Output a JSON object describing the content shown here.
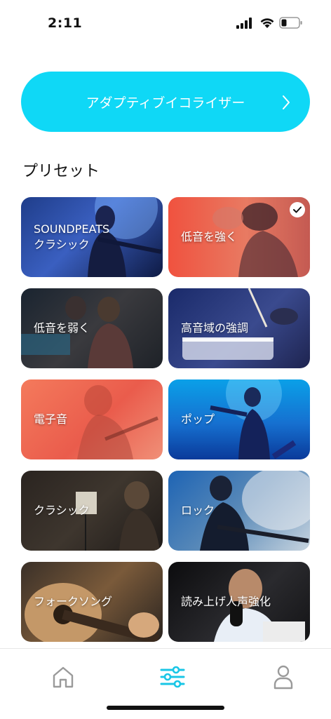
{
  "status_bar": {
    "time": "2:11"
  },
  "eq_button": {
    "label": "アダプティブイコライザー"
  },
  "presets": {
    "title": "プリセット",
    "items": [
      {
        "label": "SOUNDPEATS\nクラシック",
        "selected": false
      },
      {
        "label": "低音を強く",
        "selected": true
      },
      {
        "label": "低音を弱く",
        "selected": false
      },
      {
        "label": "高音域の強調",
        "selected": false
      },
      {
        "label": "電子音",
        "selected": false
      },
      {
        "label": "ポップ",
        "selected": false
      },
      {
        "label": "クラシック",
        "selected": false
      },
      {
        "label": "ロック",
        "selected": false
      },
      {
        "label": "フォークソング",
        "selected": false
      },
      {
        "label": "読み上げ人声強化",
        "selected": false
      }
    ]
  },
  "tab_bar": {
    "items": [
      {
        "icon": "home-icon",
        "active": false
      },
      {
        "icon": "equalizer-icon",
        "active": true
      },
      {
        "icon": "profile-icon",
        "active": false
      }
    ]
  },
  "colors": {
    "accent": "#0fd8f6",
    "active_tab": "#19c6e6",
    "inactive_tab": "#9a9a9a"
  }
}
